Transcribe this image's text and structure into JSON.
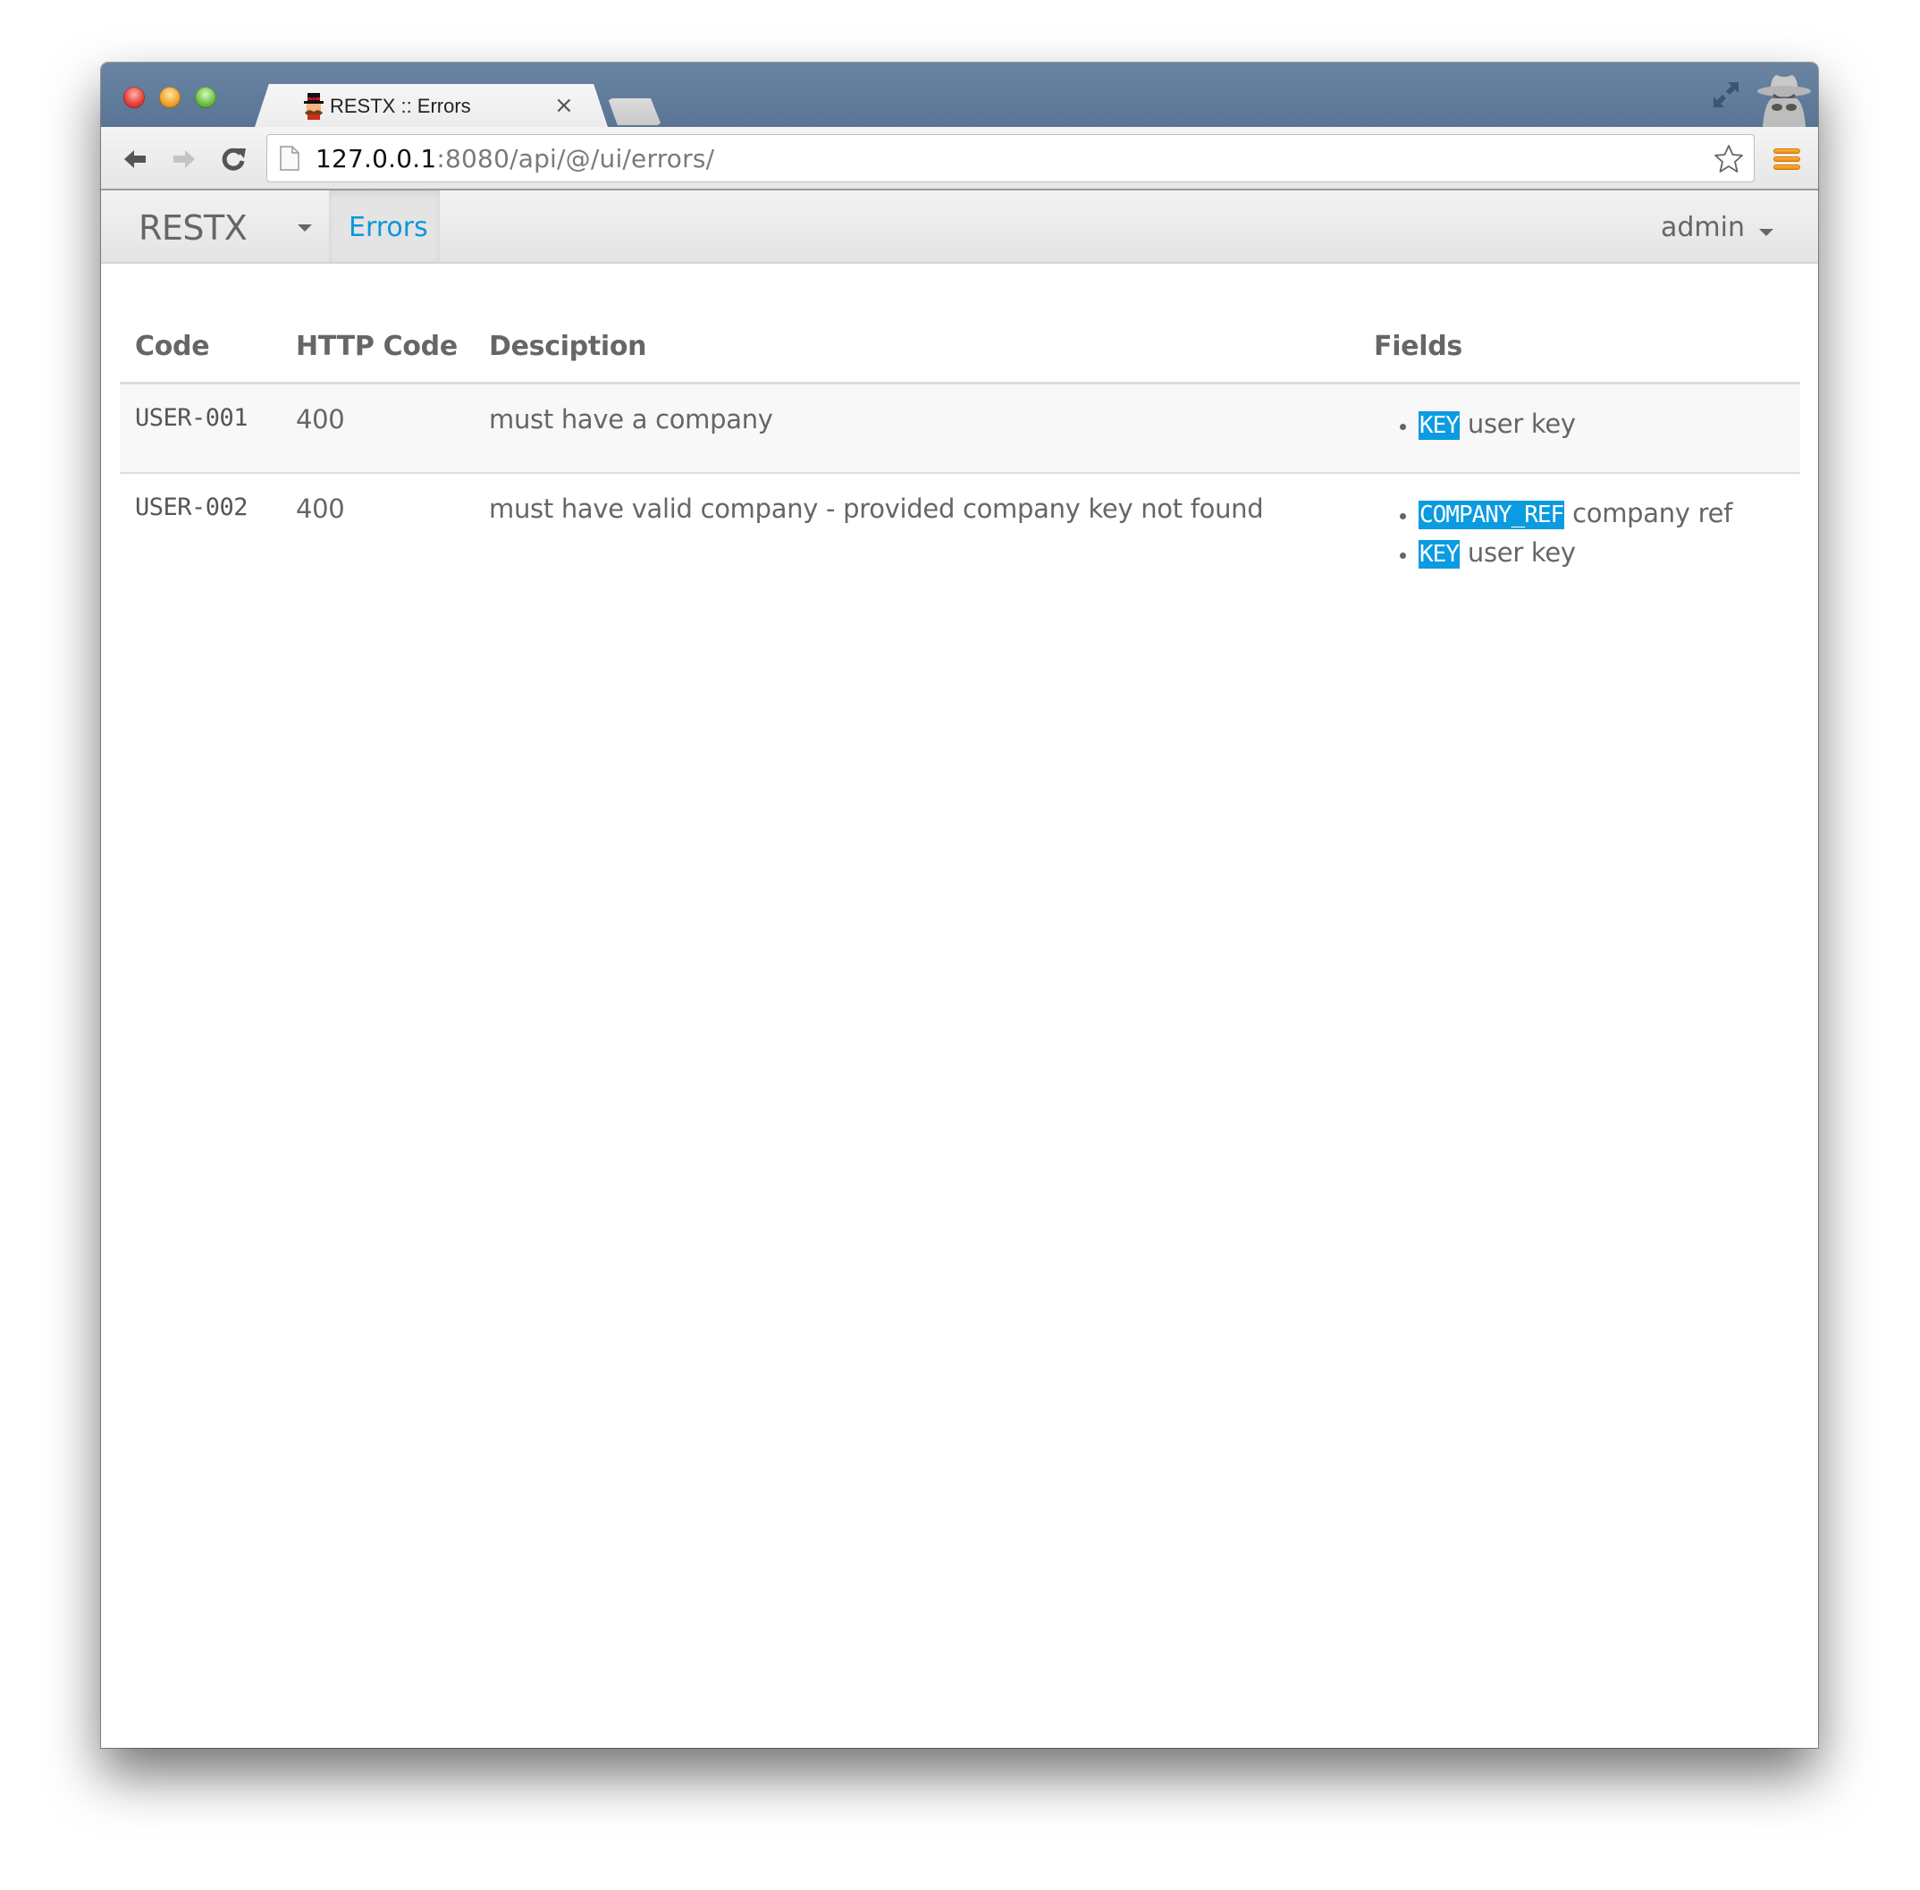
{
  "browser": {
    "tab_title": "RESTX :: Errors",
    "tab_close": "×",
    "url_host": "127.0.0.1",
    "url_rest": ":8080/api/@/ui/errors/",
    "icons": {
      "back": "arrow-left",
      "forward": "arrow-right",
      "reload": "reload",
      "bookmark": "star",
      "menu": "hamburger",
      "fullscreen": "expand-arrows",
      "incognito": "incognito-spy"
    },
    "colors": {
      "titlebar": "#5f7a99",
      "menu": "#f39c1a"
    }
  },
  "navbar": {
    "brand": "RESTX",
    "tabs": [
      {
        "label": "Errors",
        "active": true
      }
    ],
    "user": "admin",
    "colors": {
      "active_link": "#0a97d9"
    }
  },
  "table": {
    "headers": [
      "Code",
      "HTTP Code",
      "Desciption",
      "Fields"
    ],
    "rows": [
      {
        "code": "USER-001",
        "http_code": "400",
        "description": "must have a company",
        "fields": [
          {
            "name": "KEY",
            "description": "user key"
          }
        ]
      },
      {
        "code": "USER-002",
        "http_code": "400",
        "description": "must have valid company - provided company key not found",
        "fields": [
          {
            "name": "COMPANY_REF",
            "description": "company ref"
          },
          {
            "name": "KEY",
            "description": "user key"
          }
        ]
      }
    ],
    "colors": {
      "field_badge": "#0a9be0"
    }
  }
}
